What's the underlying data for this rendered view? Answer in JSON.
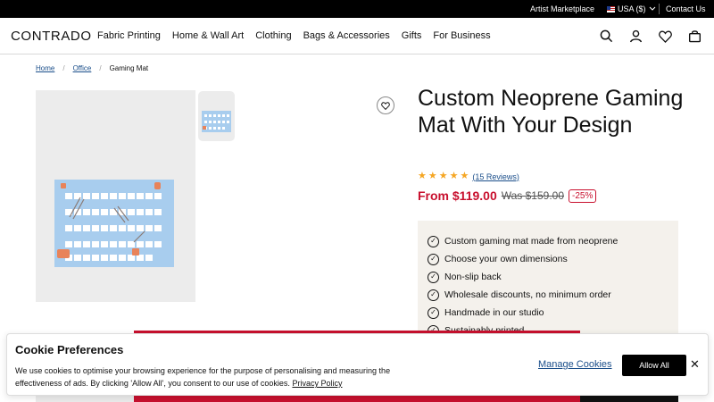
{
  "topbar": {
    "artist_marketplace": "Artist Marketplace",
    "country": "USA ($)",
    "contact": "Contact Us"
  },
  "nav": {
    "logo": "CONTRADO",
    "links": [
      "Fabric Printing",
      "Home & Wall Art",
      "Clothing",
      "Bags & Accessories",
      "Gifts",
      "For Business"
    ],
    "icons": [
      "search-icon",
      "account-icon",
      "wishlist-icon",
      "cart-icon"
    ]
  },
  "breadcrumb": [
    "Home",
    "Office",
    "Gaming Mat"
  ],
  "product": {
    "title": "Custom Neoprene Gaming Mat With Your Design",
    "stars": 5,
    "reviews": "(15 Reviews)",
    "price": "From $119.00",
    "was_price": "Was $159.00",
    "discount": "-25%",
    "features": [
      "Custom gaming mat made from neoprene",
      "Choose your own dimensions",
      "Non-slip back",
      "Wholesale discounts, no minimum order",
      "Handmade in our studio",
      "Sustainably printed"
    ]
  },
  "cookie": {
    "title": "Cookie Preferences",
    "text": "We use cookies to optimise your browsing experience for the purpose of personalising and measuring the effectiveness of ads. By clicking 'Allow All', you consent to our use of cookies.",
    "privacy_link": "Privacy Policy",
    "manage": "Manage Cookies",
    "allow": "Allow All"
  },
  "colors": {
    "accent_red": "#c8102e",
    "star": "#f5a623",
    "link": "#1a4e8a",
    "feature_bg": "#f4f1ec"
  }
}
